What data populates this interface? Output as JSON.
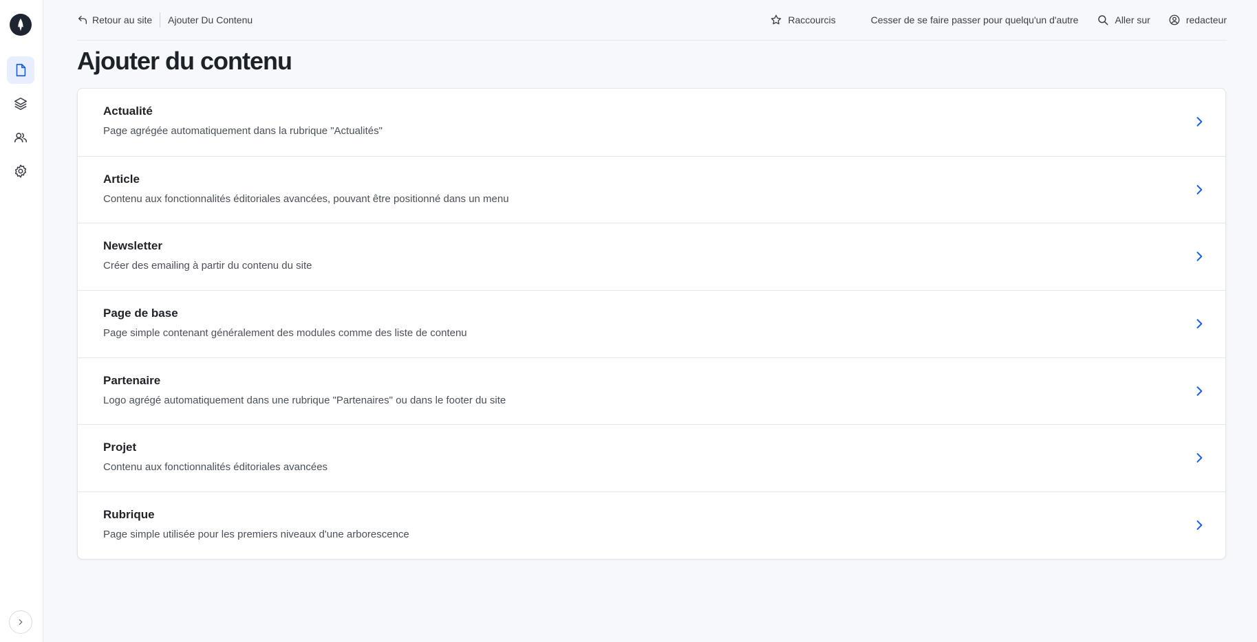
{
  "sidebar": {
    "logo_icon": "rocket-logo-icon",
    "items": [
      {
        "name": "content",
        "icon": "file-icon",
        "active": true
      },
      {
        "name": "layers",
        "icon": "layers-icon",
        "active": false
      },
      {
        "name": "users",
        "icon": "users-icon",
        "active": false
      },
      {
        "name": "settings",
        "icon": "gear-icon",
        "active": false
      }
    ],
    "expand_icon": "chevron-right-icon"
  },
  "topbar": {
    "back_label": "Retour au site",
    "breadcrumb": "Ajouter Du Contenu",
    "shortcuts_label": "Raccourcis",
    "impersonate_label": "Cesser de se faire passer pour quelqu'un d'autre",
    "goto_label": "Aller sur",
    "user_label": "redacteur"
  },
  "page": {
    "title": "Ajouter du contenu"
  },
  "content_types": [
    {
      "title": "Actualité",
      "description": "Page agrégée automatiquement dans la rubrique \"Actualités\""
    },
    {
      "title": "Article",
      "description": "Contenu aux fonctionnalités éditoriales avancées, pouvant être positionné dans un menu"
    },
    {
      "title": "Newsletter",
      "description": "Créer des emailing à partir du contenu du site"
    },
    {
      "title": "Page de base",
      "description": "Page simple contenant généralement des modules comme des liste de contenu"
    },
    {
      "title": "Partenaire",
      "description": "Logo agrégé automatiquement dans une rubrique \"Partenaires\" ou dans le footer du site"
    },
    {
      "title": "Projet",
      "description": "Contenu aux fonctionnalités éditoriales avancées"
    },
    {
      "title": "Rubrique",
      "description": "Page simple utilisée pour les premiers niveaux d'une arborescence"
    }
  ],
  "colors": {
    "accent": "#1f5fd1",
    "active_bg": "#e7efff",
    "text_dark": "#1f2328"
  }
}
